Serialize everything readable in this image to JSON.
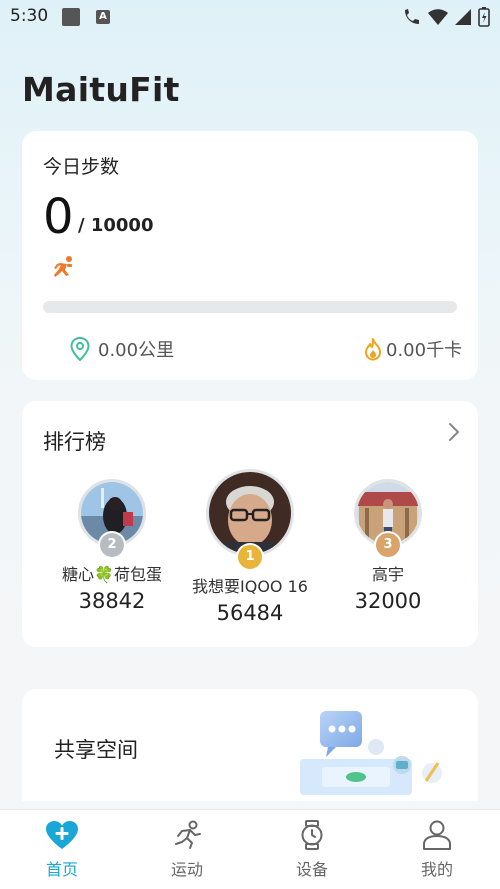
{
  "status_bar": {
    "time": "5:30"
  },
  "app": {
    "title": "MaituFit"
  },
  "steps_card": {
    "label": "今日步数",
    "count": "0",
    "goal": "/ 10000",
    "progress": 0.0,
    "distance": "0.00公里",
    "calories": "0.00千卡"
  },
  "leaderboard": {
    "title": "排行榜",
    "entries": [
      {
        "rank": "2",
        "name": "糖心🍀荷包蛋",
        "steps": "38842",
        "medal_color": "#b7bcc2"
      },
      {
        "rank": "1",
        "name": "我想要IQOO 16",
        "steps": "56484",
        "medal_color": "#e8b53a"
      },
      {
        "rank": "3",
        "name": "高宇",
        "steps": "32000",
        "medal_color": "#d9a36a"
      }
    ]
  },
  "share": {
    "title": "共享空间"
  },
  "tabs": [
    {
      "label": "首页",
      "icon": "heart-plus-icon",
      "active": true
    },
    {
      "label": "运动",
      "icon": "runner-icon",
      "active": false
    },
    {
      "label": "设备",
      "icon": "watch-icon",
      "active": false
    },
    {
      "label": "我的",
      "icon": "profile-icon",
      "active": false
    }
  ],
  "colors": {
    "accent": "#1aa6d6",
    "progress": "#f07a2a",
    "location": "#3fbf9b",
    "flame": "#f0a31c"
  }
}
